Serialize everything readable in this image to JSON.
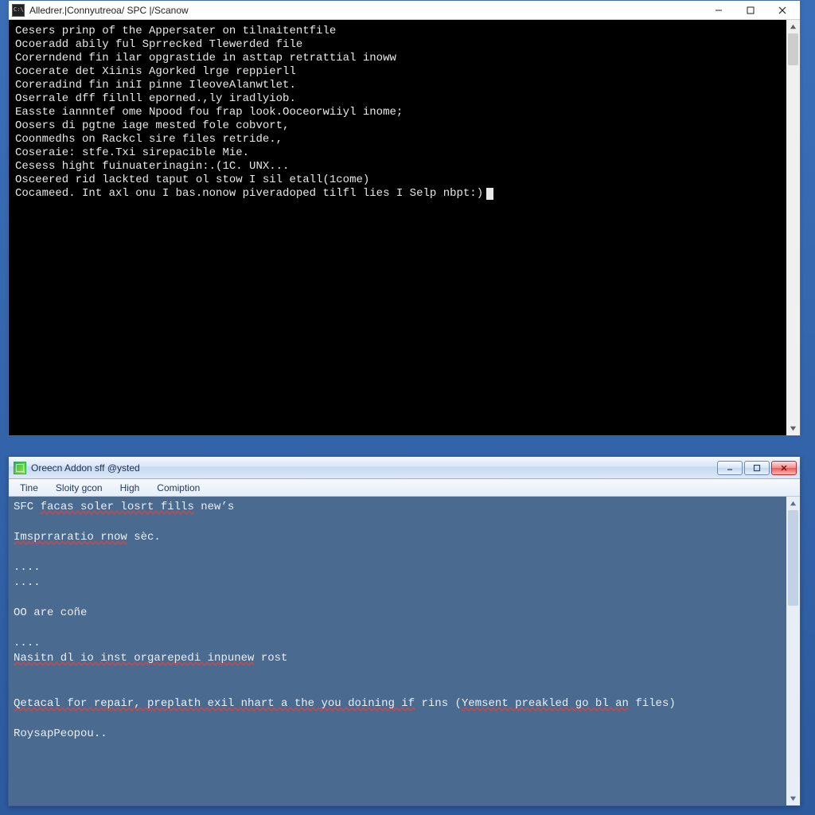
{
  "cmd": {
    "title": "Alledrer.|Connyutreoa/ SPC |/Scanow",
    "lines": [
      "Cesers prinp of the Appersater on tilnaitentfile",
      "Ocoeradd abily ful Sprrecked Tlewerded file",
      "Corerndend fin ilar opgrastide in asttap retrattial inoww",
      "Cocerate det Xiinis Agorked lrge reppierll",
      "Coreradind fin iniI pinne IleoveAlanwtlet.",
      "Oserrale dff filnll eporned.,ly iradlyiob.",
      "",
      "Easste iannntef ome Npood fou frap look.Ooceorwiiyl inome;",
      "Oosers di pgtne iage mested fole cobvort,",
      "Coonmedhs on Rackcl sire files retride.,",
      "Coseraie: stfe.Txi sirepacible Mie.",
      "",
      "Cesess hight fuinuaterinagin:.(1C. UNX...",
      "Osceered rid lackted taput ol stow I sil etall(1come)",
      "Cocameed. Int axl onu I bas.nonow piveradoped tilfl lies I Selp nbpt:)"
    ]
  },
  "note": {
    "title": "Oreecn Addon sff @ysted",
    "menu": [
      "Tine",
      "Sloity gcon",
      "High",
      "Comiption"
    ],
    "segments": [
      [
        {
          "t": "SFC "
        },
        {
          "t": "facas soler losrt fills",
          "err": true
        },
        {
          "t": " new’s"
        }
      ],
      [],
      [
        {
          "t": "Imsprraratio rnow",
          "err": true
        },
        {
          "t": " sèc."
        }
      ],
      [],
      [
        {
          "t": "...."
        }
      ],
      [
        {
          "t": "...."
        }
      ],
      [],
      [
        {
          "t": "OO are coñe"
        }
      ],
      [],
      [
        {
          "t": "...."
        }
      ],
      [
        {
          "t": "Nasitn dl io inst orgarepedi inpunew",
          "err": true
        },
        {
          "t": " rost"
        }
      ],
      [],
      [],
      [
        {
          "t": "Qetacal for repair, preplath exil nhart a the you doining if",
          "err": true
        },
        {
          "t": " rins ("
        },
        {
          "t": "Yemsent preakled go bl an",
          "err": true
        },
        {
          "t": " files)"
        }
      ],
      [],
      [
        {
          "t": "RoysapPeopou.."
        }
      ]
    ]
  }
}
